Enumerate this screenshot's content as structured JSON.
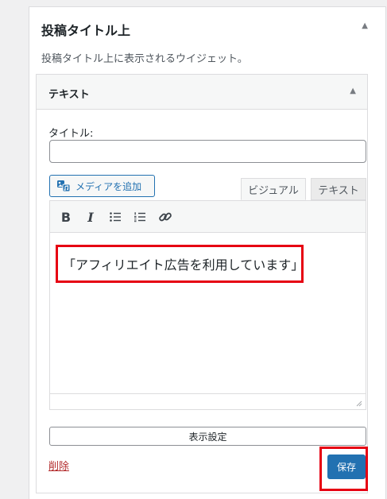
{
  "widget_area": {
    "title": "投稿タイトル上",
    "description": "投稿タイトル上に表示されるウイジェット。",
    "toggle_icon": "arrow-up-icon"
  },
  "widget": {
    "title": "テキスト",
    "toggle_icon": "arrow-up-icon",
    "title_field": {
      "label": "タイトル:",
      "value": ""
    },
    "add_media_label": "メディアを追加",
    "tabs": {
      "visual": "ビジュアル",
      "text": "テキスト",
      "active": "visual"
    },
    "toolbar": {
      "bold": "B",
      "italic": "I",
      "bullet_list_icon": "bullet-list-icon",
      "numbered_list_icon": "numbered-list-icon",
      "link_icon": "link-icon"
    },
    "content": "「アフィリエイト広告を利用しています」",
    "display_settings_label": "表示設定",
    "delete_label": "削除",
    "save_label": "保存"
  },
  "colors": {
    "accent": "#2271b1",
    "highlight": "#e60012",
    "delete": "#b32d2e"
  }
}
